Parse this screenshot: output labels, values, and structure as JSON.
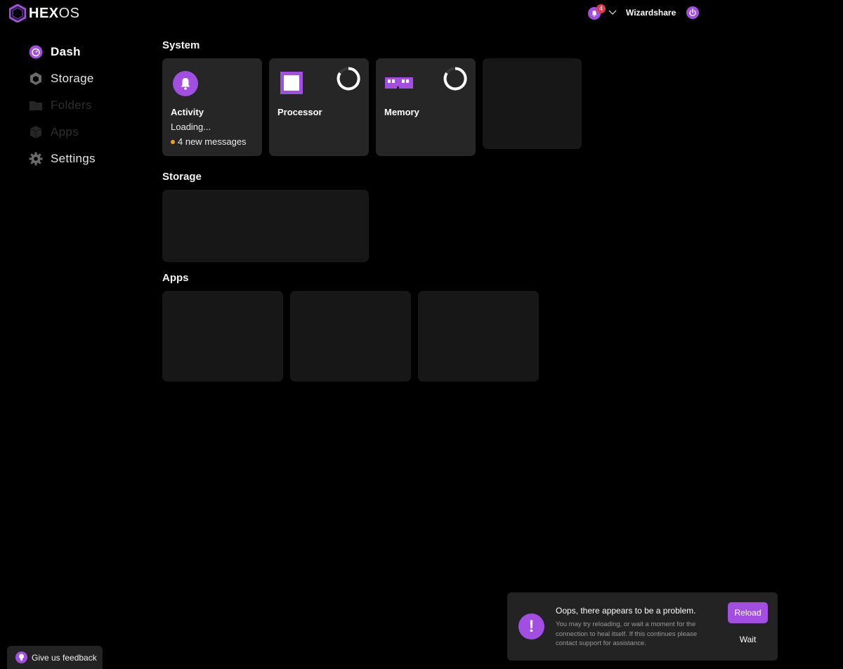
{
  "brand": {
    "logo_bold": "HEX",
    "logo_light": "OS"
  },
  "header": {
    "notification_count": "4",
    "username": "Wizardshare"
  },
  "sidebar": {
    "items": [
      {
        "label": "Dash",
        "icon": "dashboard-icon",
        "state": "active"
      },
      {
        "label": "Storage",
        "icon": "hexagon-icon",
        "state": "normal"
      },
      {
        "label": "Folders",
        "icon": "folder-icon",
        "state": "disabled"
      },
      {
        "label": "Apps",
        "icon": "cube-icon",
        "state": "disabled"
      },
      {
        "label": "Settings",
        "icon": "gear-icon",
        "state": "normal"
      }
    ]
  },
  "sections": {
    "system": "System",
    "storage": "Storage",
    "apps": "Apps"
  },
  "system_cards": {
    "activity": {
      "label": "Activity",
      "status": "Loading...",
      "messages": "4 new messages"
    },
    "processor": {
      "label": "Processor"
    },
    "memory": {
      "label": "Memory"
    }
  },
  "toast": {
    "title": "Oops, there appears to be a problem.",
    "body": "You may try reloading, or wait a moment for the connection to heal itself. If this continues please contact support for assistance.",
    "reload_label": "Reload",
    "wait_label": "Wait"
  },
  "feedback": {
    "label": "Give us feedback"
  },
  "colors": {
    "accent": "#a24ee0",
    "badge": "#e23b4a",
    "dot": "#f0a020",
    "card": "#262626",
    "placeholder": "#171717"
  }
}
